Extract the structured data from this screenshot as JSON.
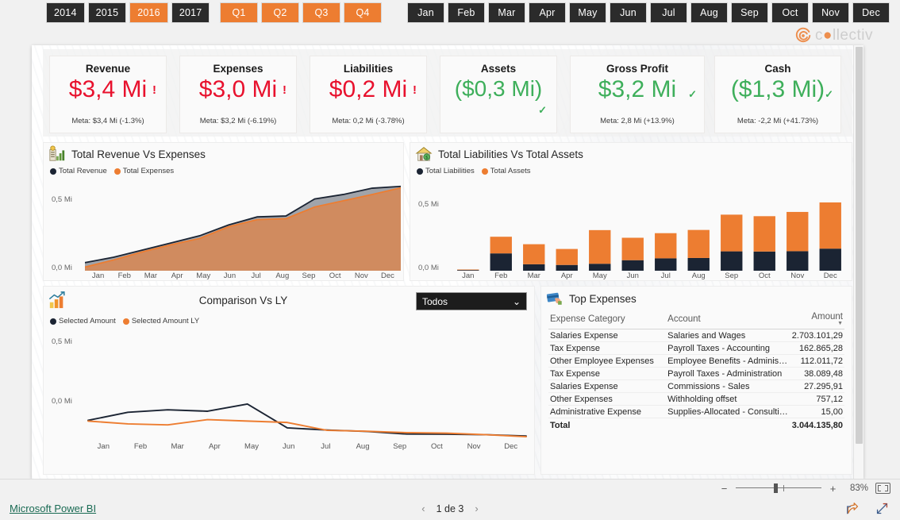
{
  "slicers": {
    "years": [
      {
        "label": "2014",
        "selected": false
      },
      {
        "label": "2015",
        "selected": false
      },
      {
        "label": "2016",
        "selected": true
      },
      {
        "label": "2017",
        "selected": false
      }
    ],
    "quarters": [
      {
        "label": "Q1",
        "selected": true
      },
      {
        "label": "Q2",
        "selected": true
      },
      {
        "label": "Q3",
        "selected": true
      },
      {
        "label": "Q4",
        "selected": true
      }
    ],
    "months": [
      {
        "label": "Jan",
        "selected": false
      },
      {
        "label": "Feb",
        "selected": false
      },
      {
        "label": "Mar",
        "selected": false
      },
      {
        "label": "Apr",
        "selected": false
      },
      {
        "label": "May",
        "selected": false
      },
      {
        "label": "Jun",
        "selected": false
      },
      {
        "label": "Jul",
        "selected": false
      },
      {
        "label": "Aug",
        "selected": false
      },
      {
        "label": "Sep",
        "selected": false
      },
      {
        "label": "Oct",
        "selected": false
      },
      {
        "label": "Nov",
        "selected": false
      },
      {
        "label": "Dec",
        "selected": false
      }
    ]
  },
  "brand": {
    "name": "collectiv",
    "accent": "#ed7d31"
  },
  "kpis": [
    {
      "title": "Revenue",
      "value": "$3,4 Mi",
      "meta": "Meta: $3,4 Mi (-1.3%)",
      "state": "bad",
      "flag": "!"
    },
    {
      "title": "Expenses",
      "value": "$3,0 Mi",
      "meta": "Meta: $3,2 Mi (-6.19%)",
      "state": "bad",
      "flag": "!"
    },
    {
      "title": "Liabilities",
      "value": "$0,2 Mi",
      "meta": "Meta: 0,2 Mi (-3.78%)",
      "state": "bad",
      "flag": "!"
    },
    {
      "title": "Assets",
      "value": "($0,3 Mi)",
      "meta": "",
      "state": "good",
      "flag": "✓"
    },
    {
      "title": "Gross Profit",
      "value": "$3,2 Mi",
      "meta": "Meta: 2,8 Mi (+13.9%)",
      "state": "good",
      "flag": "✓"
    },
    {
      "title": "Cash",
      "value": "($1,3 Mi)",
      "meta": "Meta: -2,2 Mi (+41.73%)",
      "state": "good",
      "flag": "✓"
    }
  ],
  "colors": {
    "orange": "#ed7d31",
    "navy": "#1b2433",
    "red": "#e8112d",
    "green": "#3eaf5b"
  },
  "visuals": {
    "revenue_expenses": {
      "title": "Total Revenue Vs Expenses",
      "icon": "money-chart-icon"
    },
    "liabilities_assets": {
      "title": "Total Liabilities Vs Total Assets",
      "icon": "house-money-icon"
    },
    "comparison": {
      "title": "Comparison Vs LY",
      "icon": "growth-chart-icon",
      "filter_value": "Todos"
    },
    "top_expenses": {
      "title": "Top Expenses",
      "icon": "credit-card-icon"
    }
  },
  "chart_data": [
    {
      "type": "area",
      "title": "Total Revenue Vs Expenses",
      "categories": [
        "Jan",
        "Feb",
        "Mar",
        "Apr",
        "May",
        "Jun",
        "Jul",
        "Aug",
        "Sep",
        "Oct",
        "Nov",
        "Dec"
      ],
      "series": [
        {
          "name": "Total Revenue",
          "color": "#1b2433",
          "values": [
            0.045,
            0.075,
            0.115,
            0.155,
            0.195,
            0.255,
            0.3,
            0.305,
            0.4,
            0.425,
            0.46,
            0.47
          ]
        },
        {
          "name": "Total Expenses",
          "color": "#ed7d31",
          "values": [
            0.02,
            0.06,
            0.105,
            0.145,
            0.18,
            0.245,
            0.285,
            0.29,
            0.355,
            0.39,
            0.425,
            0.462
          ]
        }
      ],
      "ylabel": "",
      "xlabel": "",
      "yticks": [
        "0,0 Mi",
        "0,5 Mi"
      ],
      "ylim": [
        0,
        0.5
      ],
      "grid": false,
      "legend_position": "top-left"
    },
    {
      "type": "bar",
      "stacked": true,
      "title": "Total Liabilities Vs Total Assets",
      "categories": [
        "Jan",
        "Feb",
        "Mar",
        "Apr",
        "May",
        "Jun",
        "Jul",
        "Aug",
        "Sep",
        "Oct",
        "Nov",
        "Dec"
      ],
      "series": [
        {
          "name": "Total Liabilities",
          "color": "#1b2433",
          "values": [
            0.004,
            0.102,
            0.038,
            0.034,
            0.041,
            0.062,
            0.073,
            0.075,
            0.114,
            0.113,
            0.115,
            0.13
          ]
        },
        {
          "name": "Total Assets",
          "color": "#ed7d31",
          "values": [
            0.003,
            0.098,
            0.118,
            0.094,
            0.198,
            0.132,
            0.148,
            0.165,
            0.216,
            0.208,
            0.231,
            0.272
          ]
        }
      ],
      "ylabel": "",
      "xlabel": "",
      "yticks": [
        "0,0 Mi",
        "0,5 Mi"
      ],
      "ylim": [
        0,
        0.5
      ],
      "grid": false,
      "legend_position": "top-left"
    },
    {
      "type": "line",
      "title": "Comparison Vs LY",
      "categories": [
        "Jan",
        "Feb",
        "Mar",
        "Apr",
        "May",
        "Jun",
        "Jul",
        "Aug",
        "Sep",
        "Oct",
        "Nov",
        "Dec"
      ],
      "series": [
        {
          "name": "Selected Amount",
          "color": "#1b2433",
          "values": [
            0.0,
            0.046,
            0.06,
            0.052,
            0.093,
            -0.043,
            -0.055,
            -0.063,
            -0.078,
            -0.079,
            -0.082,
            -0.089
          ]
        },
        {
          "name": "Selected Amount LY",
          "color": "#ed7d31",
          "values": [
            -0.004,
            -0.02,
            -0.026,
            0.004,
            -0.004,
            -0.012,
            -0.057,
            -0.062,
            -0.07,
            -0.073,
            -0.082,
            -0.093
          ]
        }
      ],
      "ylabel": "",
      "xlabel": "",
      "yticks": [
        "0,0 Mi",
        "0,5 Mi"
      ],
      "ylim": [
        -0.12,
        0.5
      ],
      "grid": false,
      "legend_position": "top-left"
    },
    {
      "type": "table",
      "title": "Top Expenses",
      "columns": [
        "Expense Category",
        "Account",
        "Amount"
      ],
      "sorted_by": "Amount",
      "sort_direction": "desc",
      "rows": [
        [
          "Salaries Expense",
          "Salaries and Wages",
          "2.703.101,29"
        ],
        [
          "Tax Expense",
          "Payroll Taxes - Accounting",
          "162.865,28"
        ],
        [
          "Other Employee Expenses",
          "Employee Benefits - Adminis…",
          "112.011,72"
        ],
        [
          "Tax Expense",
          "Payroll Taxes - Administration",
          "38.089,48"
        ],
        [
          "Salaries Expense",
          "Commissions - Sales",
          "27.295,91"
        ],
        [
          "Other Expenses",
          "Withholding offset",
          "757,12"
        ],
        [
          "Administrative Expense",
          "Supplies-Allocated - Consulti…",
          "15,00"
        ]
      ],
      "total_label": "Total",
      "total_value": "3.044.135,80"
    }
  ],
  "statusbar": {
    "zoom_out": "−",
    "zoom_in": "+",
    "zoom_level": "83%",
    "fit_to_page": "fit-to-page-icon"
  },
  "footer": {
    "link": "Microsoft Power BI",
    "prev": "‹",
    "page_label": "1 de 3",
    "next": "›",
    "share": "share-icon",
    "fullscreen": "fullscreen-icon"
  }
}
